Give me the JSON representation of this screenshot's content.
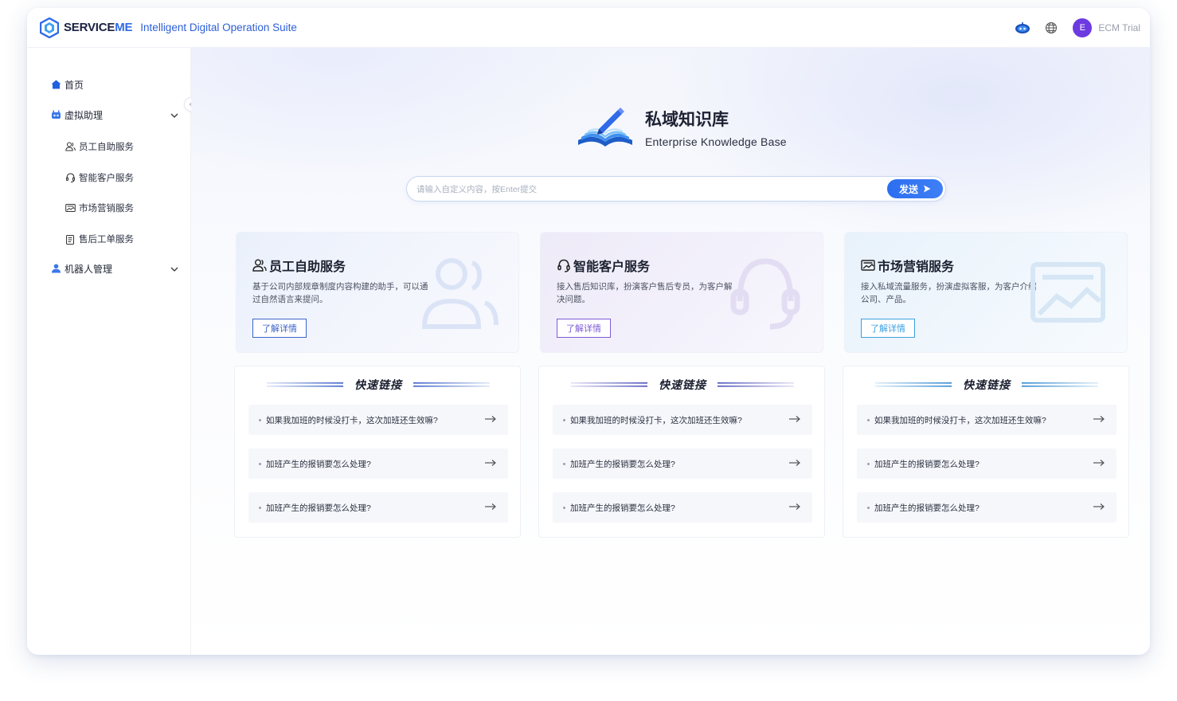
{
  "header": {
    "brand_main": "SERVICE",
    "brand_accent": "ME",
    "suite": "Intelligent Digital Operation Suite",
    "avatar_initial": "E",
    "user_name": "ECM Trial"
  },
  "sidebar": {
    "home": "首页",
    "virtual_assistant": "虚拟助理",
    "sub_items": [
      "员工自助服务",
      "智能客户服务",
      "市场营销服务",
      "售后工单服务"
    ],
    "robot_mgmt": "机器人管理"
  },
  "hero": {
    "title": "私域知识库",
    "subtitle": "Enterprise Knowledge Base"
  },
  "search": {
    "placeholder": "请输入自定义内容，按Enter提交",
    "send_label": "发送"
  },
  "cards": [
    {
      "title": "员工自助服务",
      "desc": "基于公司内部规章制度内容构建的助手，可以通过自然语言来提问。",
      "btn": "了解详情"
    },
    {
      "title": "智能客户服务",
      "desc": "接入售后知识库，扮演客户售后专员，为客户解决问题。",
      "btn": "了解详情"
    },
    {
      "title": "市场营销服务",
      "desc": "接入私域流量服务，扮演虚拟客服，为客户介绍公司、产品。",
      "btn": "了解详情"
    }
  ],
  "panels": [
    {
      "title": "快速链接",
      "links": [
        "如果我加班的时候没打卡，这次加班还生效嘛?",
        "加班产生的报销要怎么处理?",
        "加班产生的报销要怎么处理?"
      ]
    },
    {
      "title": "快速链接",
      "links": [
        "如果我加班的时候没打卡，这次加班还生效嘛?",
        "加班产生的报销要怎么处理?",
        "加班产生的报销要怎么处理?"
      ]
    },
    {
      "title": "快速链接",
      "links": [
        "如果我加班的时候没打卡，这次加班还生效嘛?",
        "加班产生的报销要怎么处理?",
        "加班产生的报销要怎么处理?"
      ]
    }
  ],
  "icons": {
    "logo": "serviceme-logo-icon",
    "robot": "robot-icon",
    "globe": "globe-icon",
    "home": "home-icon",
    "assistant": "robot-head-icon",
    "employee": "users-icon",
    "customer": "headset-icon",
    "marketing": "image-card-icon",
    "aftersale": "clipboard-icon",
    "robot_mgmt": "user-icon",
    "link_arrow": "arrow-right-icon"
  },
  "colors": {
    "brand_blue": "#2f6ae8",
    "send_button": "#2b6ef0",
    "avatar": "#6c3ae0",
    "card_btn_1": "#3d63c9",
    "card_btn_2": "#7e5bd6",
    "card_btn_3": "#3da0e0"
  }
}
